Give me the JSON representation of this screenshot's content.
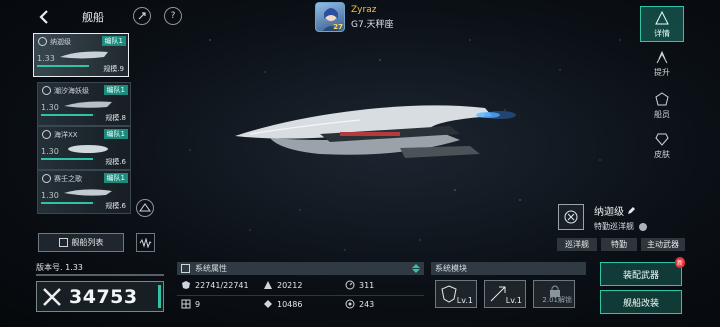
{
  "header": {
    "title": "舰船"
  },
  "player": {
    "name": "Zyraz",
    "subtitle": "G7.天秤座",
    "level": "27"
  },
  "ships": [
    {
      "name": "纳迦级",
      "fleet": "编队1",
      "level": "1.33",
      "scale": "规模.9"
    },
    {
      "name": "潮汐海妖级",
      "fleet": "编队1",
      "level": "1.30",
      "scale": "规模.8"
    },
    {
      "name": "海洋XX",
      "fleet": "编队1",
      "level": "1.30",
      "scale": "规模.6"
    },
    {
      "name": "赛壬之歌",
      "fleet": "编队1",
      "level": "1.30",
      "scale": "规模.6"
    }
  ],
  "list_button": "舰船列表",
  "version": "版本号. 1.33",
  "power": "34753",
  "attributes": {
    "title": "系统属性",
    "items": [
      {
        "icon": "shield-icon",
        "value": "22741/22741"
      },
      {
        "icon": "armor-icon",
        "value": "20212"
      },
      {
        "icon": "speed-icon",
        "value": "311"
      },
      {
        "icon": "grid-icon",
        "value": "9"
      },
      {
        "icon": "cargo-icon",
        "value": "10486"
      },
      {
        "icon": "radar-icon",
        "value": "243"
      }
    ]
  },
  "modules": {
    "title": "系统模块",
    "slots": [
      {
        "label": "Lv.1"
      },
      {
        "label": "Lv.1"
      },
      {
        "label": "2.01解锁"
      }
    ]
  },
  "tabs": [
    {
      "label": "详情"
    },
    {
      "label": "提升"
    },
    {
      "label": "船员"
    },
    {
      "label": "皮肤"
    }
  ],
  "ship_info": {
    "class_name": "纳迦级",
    "type": "特勤巡洋舰",
    "tags": [
      "巡洋舰",
      "特勤",
      "主动武器"
    ]
  },
  "actions": {
    "equip": "装配武器",
    "refit": "舰船改装",
    "new_badge": "新"
  },
  "colors": {
    "accent": "#2fc4a8",
    "gold": "#f0c24a",
    "alert": "#e2333a"
  }
}
